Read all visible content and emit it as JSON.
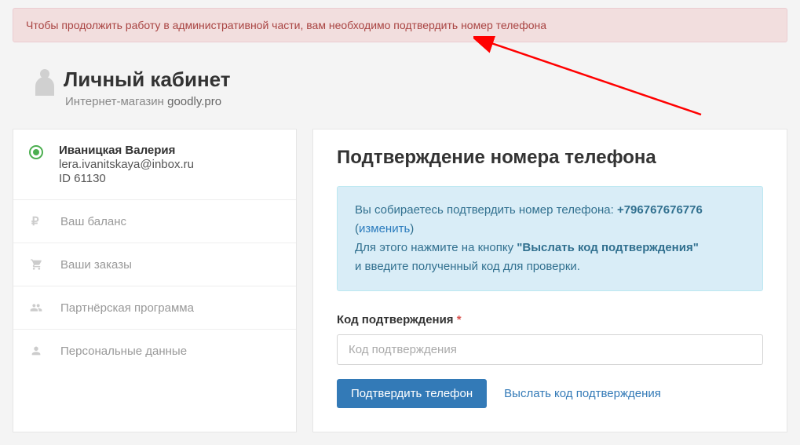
{
  "alert": {
    "message": "Чтобы продолжить работу в административной части, вам необходимо подтвердить номер телефона"
  },
  "header": {
    "title": "Личный кабинет",
    "subtitle_prefix": "Интернет-магазин ",
    "store_name": "goodly.pro"
  },
  "sidebar": {
    "user": {
      "name": "Иваницкая Валерия",
      "email": "lera.ivanitskaya@inbox.ru",
      "id": "ID 61130"
    },
    "nav": [
      {
        "icon": "ruble-icon",
        "label": "Ваш баланс"
      },
      {
        "icon": "cart-icon",
        "label": "Ваши заказы"
      },
      {
        "icon": "users-icon",
        "label": "Партнёрская программа"
      },
      {
        "icon": "user-icon",
        "label": "Персональные данные"
      }
    ]
  },
  "main": {
    "heading": "Подтверждение номера телефона",
    "info": {
      "line1_prefix": "Вы собираетесь подтвердить номер телефона: ",
      "phone": "+796767676776",
      "change_label": "изменить",
      "line2_prefix": "Для этого нажмите на кнопку ",
      "line2_emphasis": "\"Выслать код подтверждения\"",
      "line3": "и введите полученный код для проверки."
    },
    "form": {
      "label": "Код подтверждения",
      "required_marker": "*",
      "placeholder": "Код подтверждения",
      "submit_label": "Подтвердить телефон",
      "resend_label": "Выслать код подтверждения"
    }
  }
}
